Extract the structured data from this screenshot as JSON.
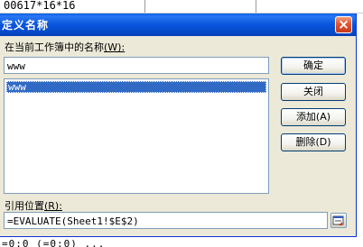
{
  "background": {
    "top_cell_text": "00617*16*16",
    "bottom_partial_text": "=0:0 (=0:0)  ..."
  },
  "dialog": {
    "title": "定义名称",
    "close_glyph": "×",
    "names_label": "在当前工作簿中的名称",
    "names_accel": "(W):",
    "name_input_value": "www",
    "names_list": [
      {
        "label": "www",
        "selected": true
      }
    ],
    "refers_label": "引用位置",
    "refers_accel": "(R):",
    "refers_value": "=EVALUATE(Sheet1!$E$2)",
    "buttons": {
      "ok": "确定",
      "close": "关闭",
      "add": "添加(A)",
      "delete": "删除(D)"
    }
  },
  "colors": {
    "titlebar": "#0855dd",
    "dialog_face": "#ece9d8",
    "selection": "#316ac5",
    "close_button": "#e0552e"
  },
  "icons": {
    "close": "close-icon",
    "collapse_dialog": "collapse-dialog-icon"
  }
}
